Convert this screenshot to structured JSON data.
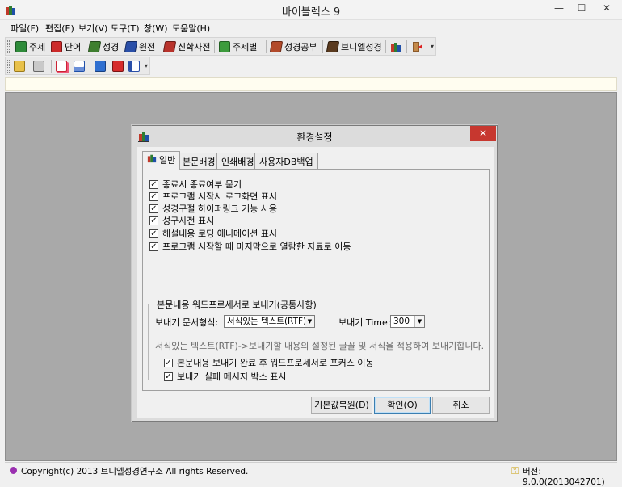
{
  "window": {
    "title": "바이블렉스 9",
    "controls": {
      "minimize": "—",
      "maximize": "☐",
      "close": "✕"
    }
  },
  "menu": [
    "파일(F)",
    "편집(E)",
    "보기(V)",
    "도구(T)",
    "창(W)",
    "도움말(H)"
  ],
  "toolbar1": {
    "items": [
      {
        "label": "주제",
        "icon": "book-green-icon",
        "color": "#2e8b3a"
      },
      {
        "label": "단어",
        "icon": "book-red-icon",
        "color": "#cc2a2a"
      },
      {
        "label": "성경",
        "icon": "bible-green-icon",
        "color": "#3f7f2f"
      },
      {
        "label": "원전",
        "icon": "bible-blue-icon",
        "color": "#2a4fa8"
      },
      {
        "label": "신학사전",
        "icon": "dictionary-red-icon",
        "color": "#b8322b"
      },
      {
        "label": "주제별",
        "icon": "topic-green-icon",
        "color": "#3c9b3c"
      },
      {
        "label": "성경공부",
        "icon": "study-icon",
        "color": "#b24a2a"
      },
      {
        "label": "브니엘성경",
        "icon": "peniel-bible-icon",
        "color": "#5a3a1e"
      }
    ],
    "more": "▾"
  },
  "status": {
    "copyright": "Copyright(c) 2013 브니엘성경연구소 All rights Reserved.",
    "version": "버전: 9.0.0(2013042701)"
  },
  "dialog": {
    "title": "환경설정",
    "close": "✕",
    "tabs": [
      "일반",
      "본문배경",
      "인쇄배경",
      "사용자DB백업"
    ],
    "options": [
      {
        "label": "종료시 종료여부 묻기",
        "checked": true
      },
      {
        "label": "프로그램 시작시 로고화면 표시",
        "checked": true
      },
      {
        "label": "성경구절 하이퍼링크 기능 사용",
        "checked": true
      },
      {
        "label": "성구사전 표시",
        "checked": true
      },
      {
        "label": "해설내용 로딩 에니메이션 표시",
        "checked": true
      },
      {
        "label": "프로그램 시작할 때 마지막으로 열람한 자료로 이동",
        "checked": true
      }
    ],
    "group": {
      "title": "본문내용 워드프로세서로 보내기(공통사항)",
      "format_label": "보내기 문서형식:",
      "format_value": "서식있는 텍스트(RTF)",
      "time_label": "보내기 Time:",
      "time_value": "300",
      "hint": "서식있는 텍스트(RTF)->보내기할 내용의 설정된 글꼴 및 서식을 적용하여 보내기합니다.",
      "options": [
        {
          "label": "본문내용 보내기 완료 후 워드프로세서로 포커스 이동",
          "checked": true
        },
        {
          "label": "보내기 실패 메시지 박스 표시",
          "checked": true
        }
      ]
    },
    "buttons": {
      "reset": "기본값복원(D)",
      "ok": "확인(O)",
      "cancel": "취소"
    }
  },
  "colors": {
    "workspace": "#a9a9a9",
    "close_red": "#c7372f",
    "accent_blue": "#3c7fb1"
  }
}
